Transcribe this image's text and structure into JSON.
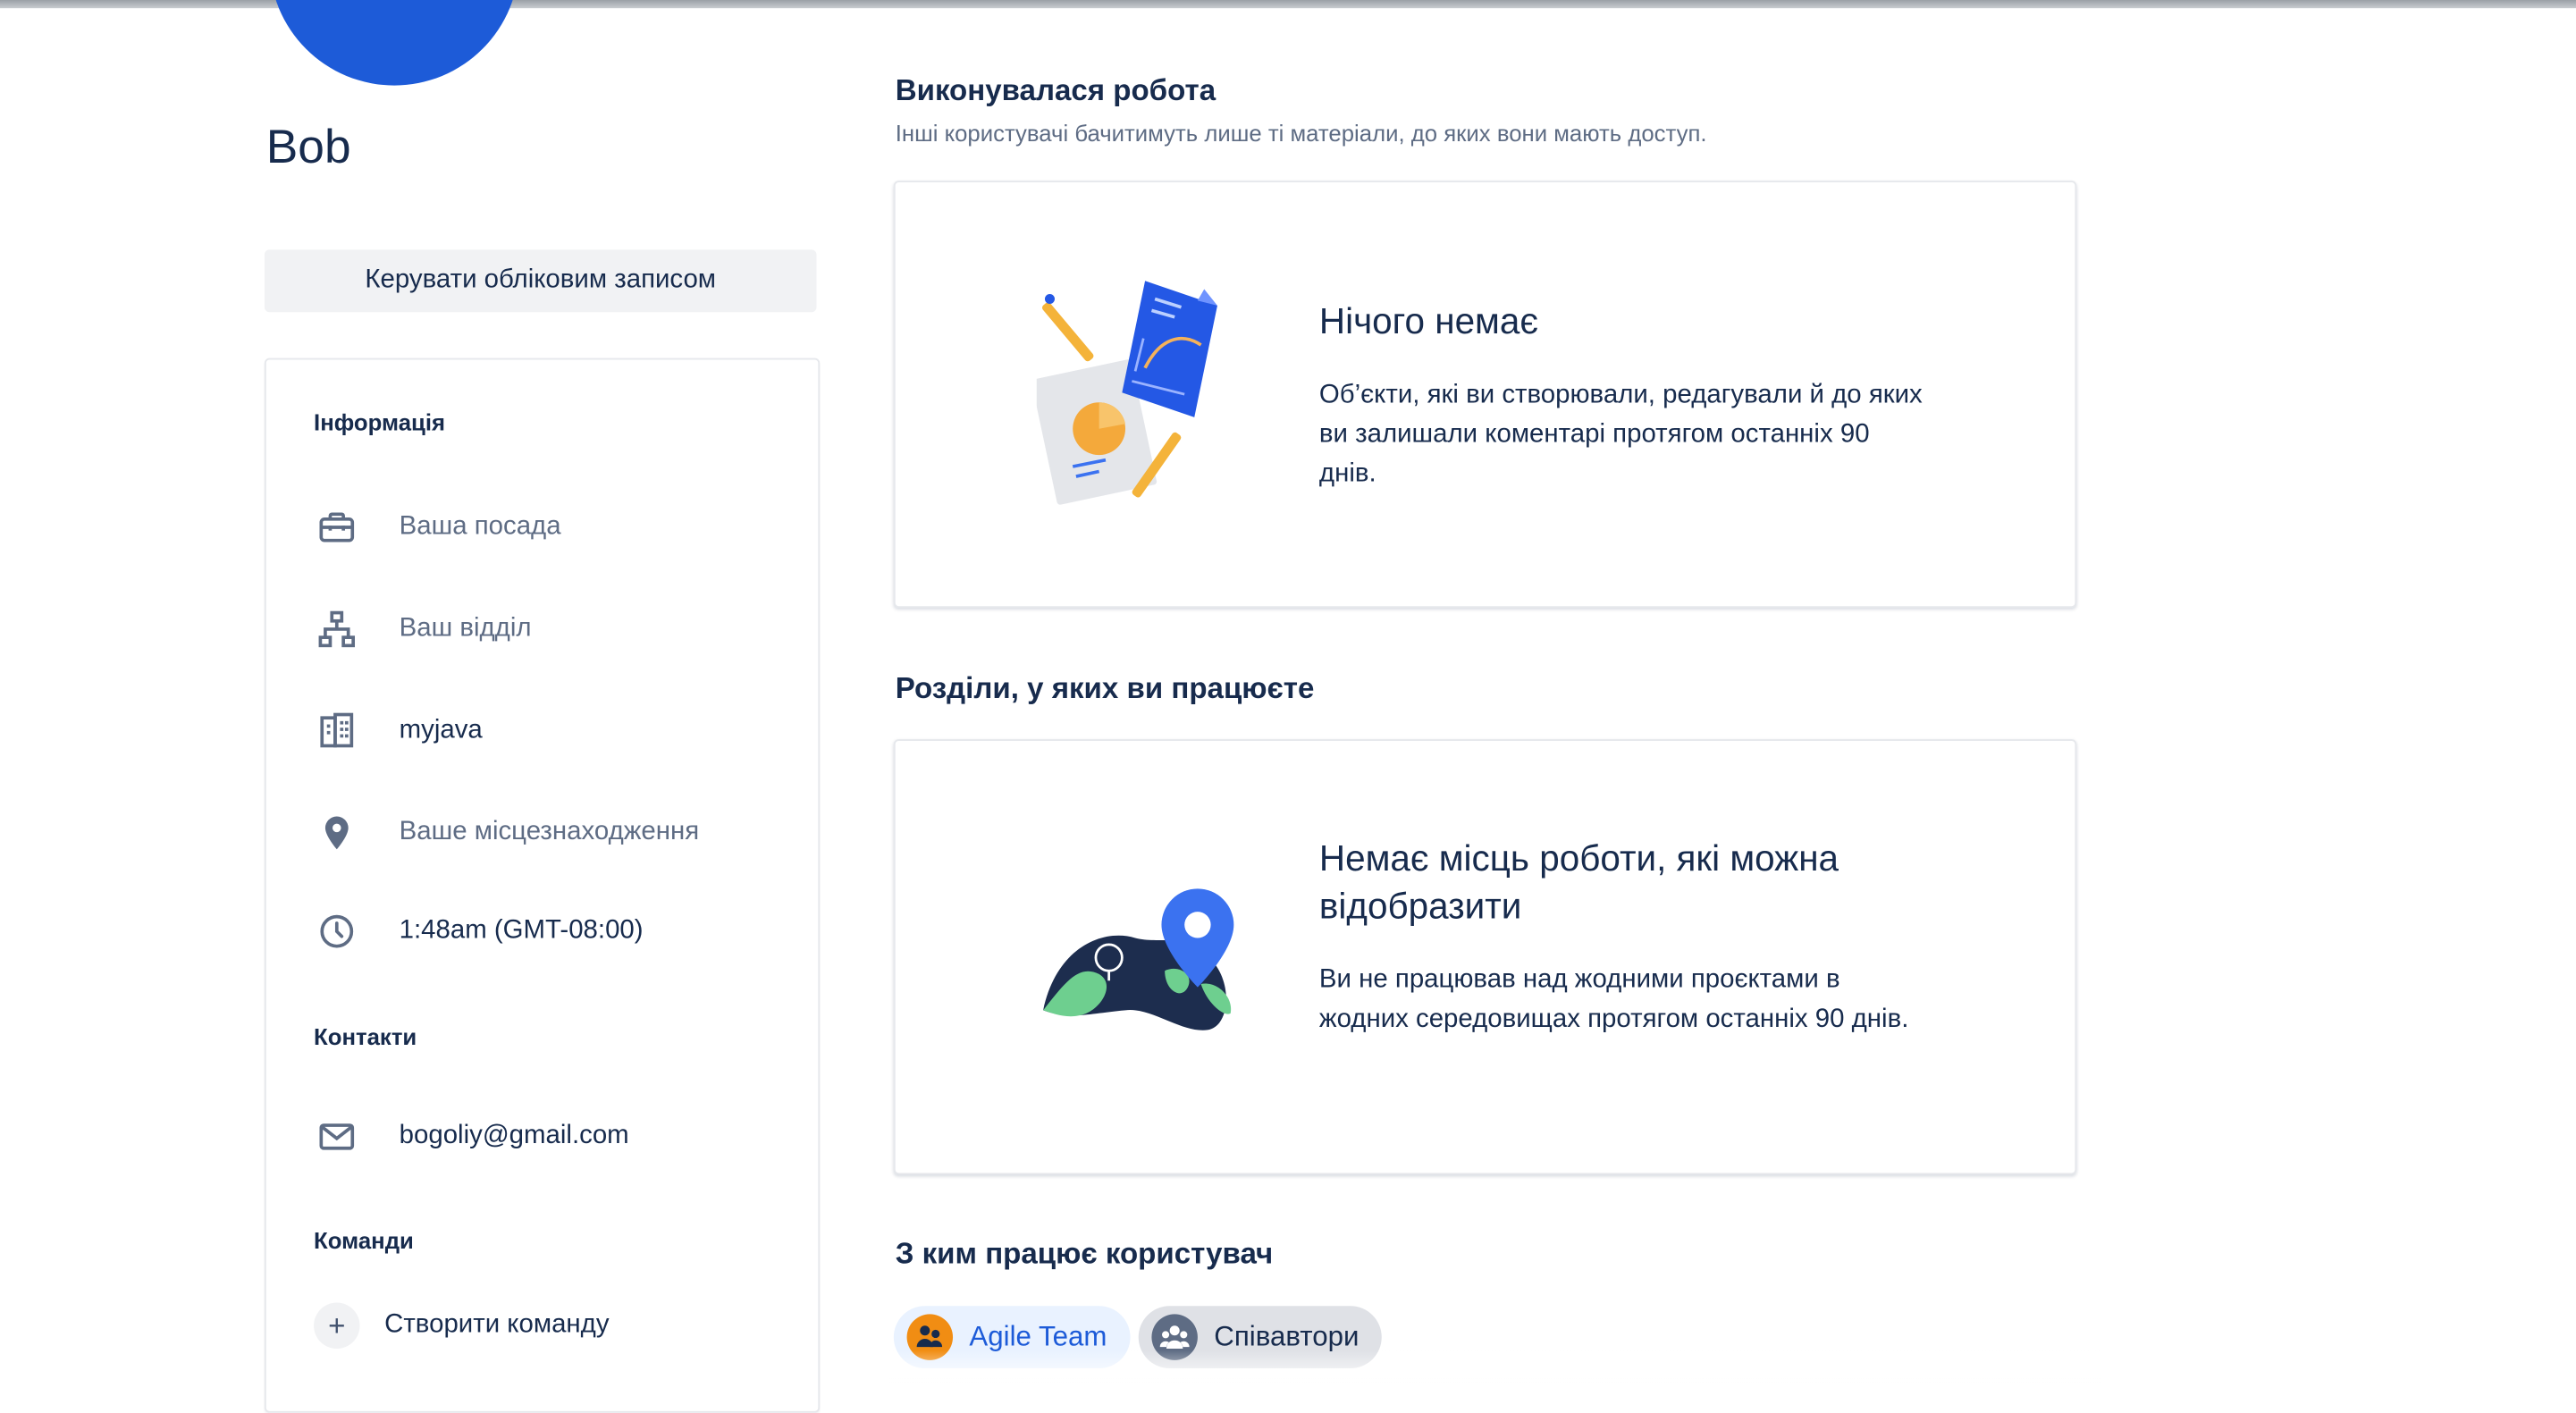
{
  "profile": {
    "name": "Bob",
    "manage_account_label": "Керувати обліковим записом"
  },
  "info": {
    "heading": "Інформація",
    "job_title": "Ваша посада",
    "department": "Ваш відділ",
    "organization": "myjava",
    "location": "Ваше місцезнаходження",
    "local_time": "1:48am (GMT-08:00)"
  },
  "contacts": {
    "heading": "Контакти",
    "email": "bogoliy@gmail.com"
  },
  "teams": {
    "heading": "Команди",
    "create_label": "Створити команду"
  },
  "work": {
    "heading": "Виконувалася робота",
    "subtitle": "Інші користувачі бачитимуть лише ті матеріали, до яких вони мають доступ.",
    "empty_title": "Нічого немає",
    "empty_desc": "Об’єкти, які ви створювали, редагували й до яких ви залишали коментарі протягом останніх 90 днів."
  },
  "places": {
    "heading": "Розділи, у яких ви працюєте",
    "empty_title": "Немає місць роботи, які можна відобразити",
    "empty_desc": "Ви не працював над жодними проєктами в жодних середовищах протягом останніх 90 днів."
  },
  "collaborators": {
    "heading": "З ким працює користувач",
    "chips": [
      {
        "label": "Agile Team",
        "icon": "team-icon",
        "color": "#1d5bd8",
        "bg": "#e9f2ff",
        "icon_bg": "#f18d13"
      },
      {
        "label": "Співавтори",
        "icon": "people-icon",
        "color": "#172b4d",
        "bg": "#dfe1e6",
        "icon_bg": "#5e6c84"
      }
    ]
  },
  "colors": {
    "accent": "#1d5bd8",
    "text": "#172b4d",
    "subtle": "#5e6c84"
  }
}
